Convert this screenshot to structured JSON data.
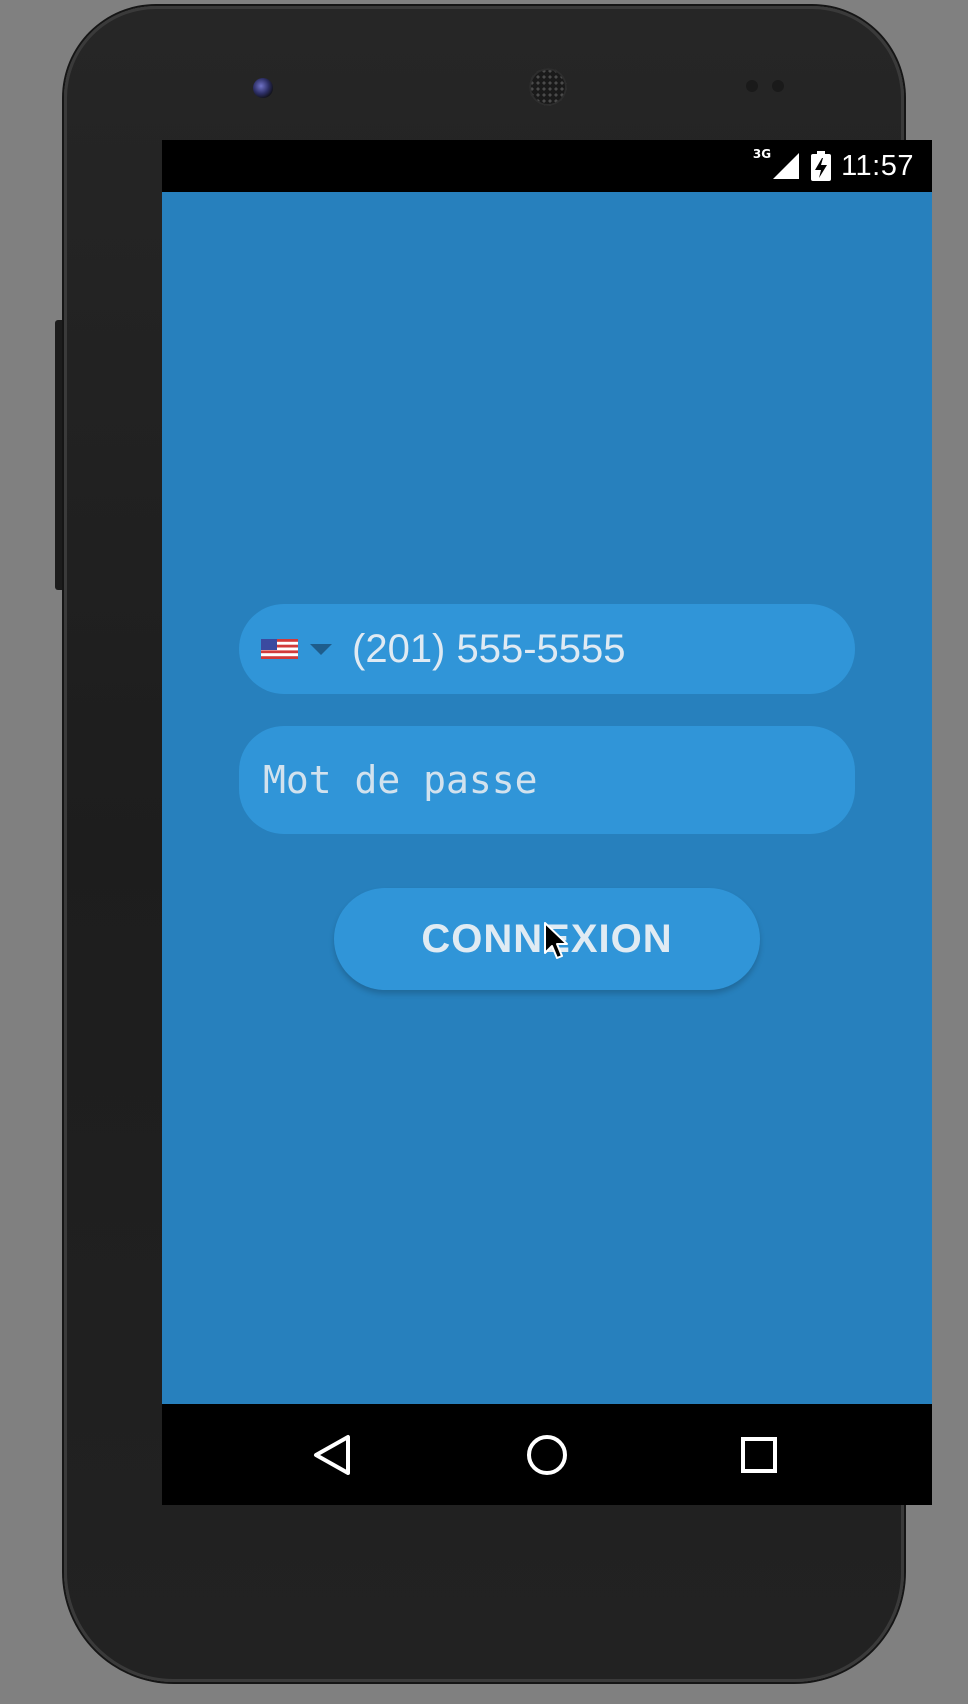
{
  "status_bar": {
    "network_type": "3G",
    "time": "11:57",
    "icons": [
      "signal-icon",
      "battery-charging-icon"
    ]
  },
  "login": {
    "country_flag": "flag-us-icon",
    "phone_value": "(201) 555-5555",
    "password_placeholder": "Mot de passe",
    "submit_label": "CONNEXION"
  },
  "navigation": {
    "icons": [
      "back-icon",
      "home-icon",
      "recent-apps-icon"
    ]
  },
  "colors": {
    "background": "#2780bd",
    "field": "#3095d8",
    "text": "#dfeaf3"
  }
}
